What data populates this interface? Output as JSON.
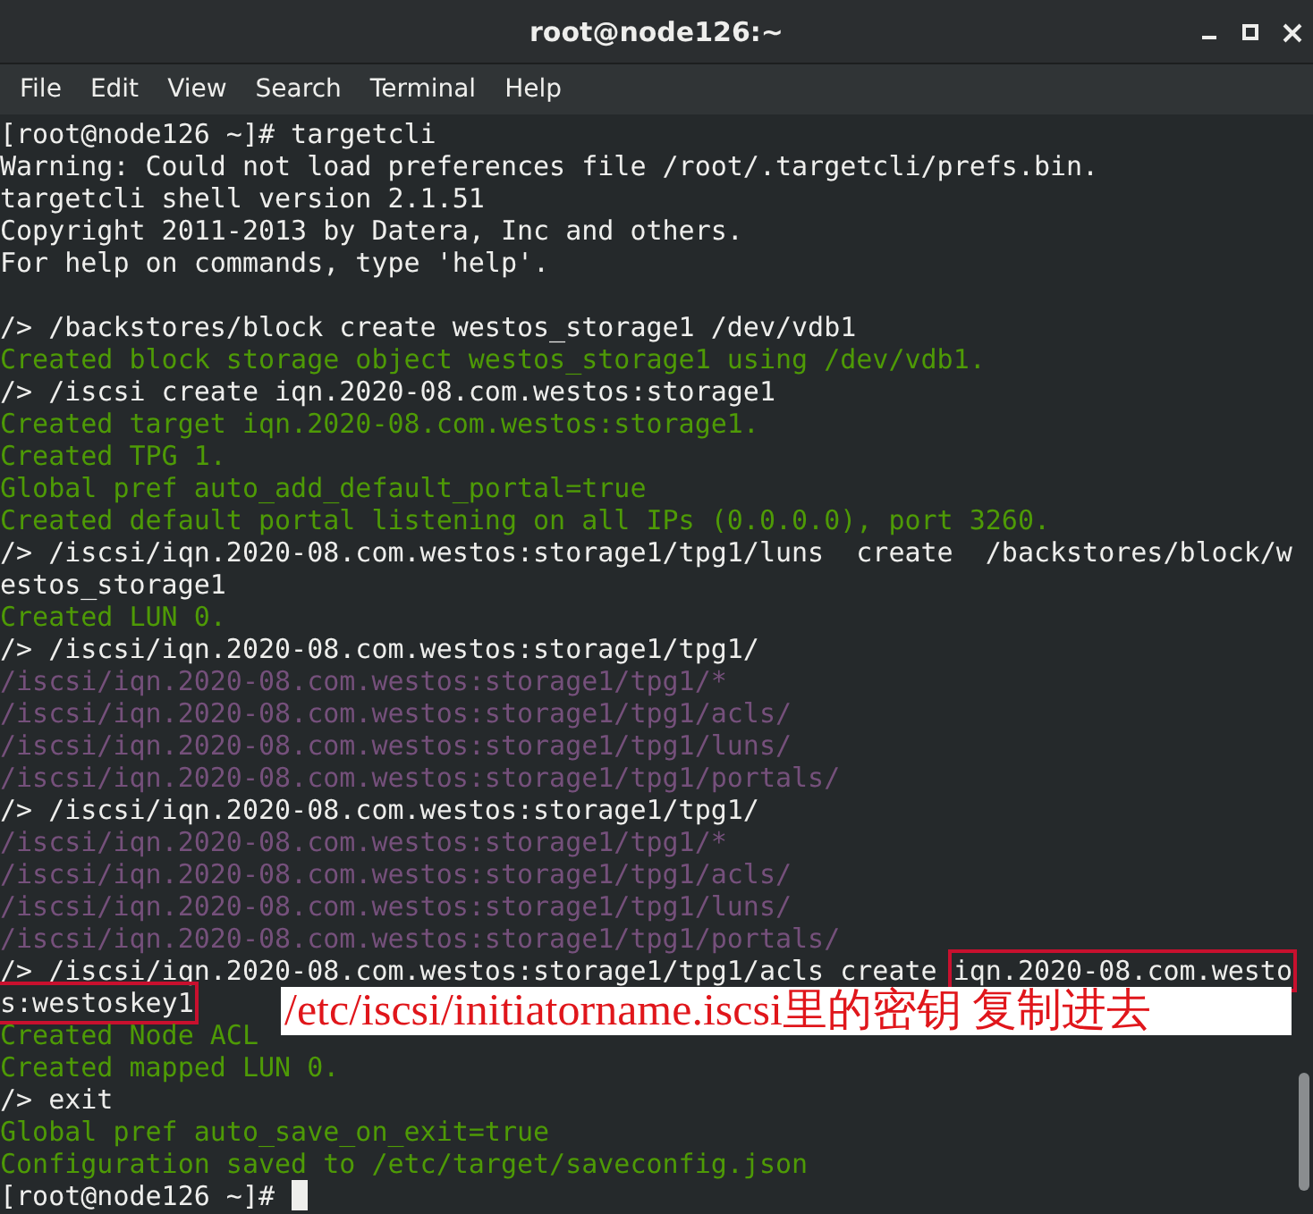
{
  "window": {
    "title": "root@node126:~"
  },
  "menu": [
    "File",
    "Edit",
    "View",
    "Search",
    "Terminal",
    "Help"
  ],
  "lines": [
    {
      "kind": "command",
      "text": "[root@node126 ~]# targetcli"
    },
    {
      "kind": "command",
      "text": "Warning: Could not load preferences file /root/.targetcli/prefs.bin."
    },
    {
      "kind": "command",
      "text": "targetcli shell version 2.1.51"
    },
    {
      "kind": "command",
      "text": "Copyright 2011-2013 by Datera, Inc and others."
    },
    {
      "kind": "command",
      "text": "For help on commands, type 'help'."
    },
    {
      "kind": "blank"
    },
    {
      "kind": "command",
      "text": "/> /backstores/block create westos_storage1 /dev/vdb1"
    },
    {
      "kind": "output",
      "text": "Created block storage object westos_storage1 using /dev/vdb1."
    },
    {
      "kind": "command",
      "text": "/> /iscsi create iqn.2020-08.com.westos:storage1"
    },
    {
      "kind": "output",
      "text": "Created target iqn.2020-08.com.westos:storage1."
    },
    {
      "kind": "output",
      "text": "Created TPG 1."
    },
    {
      "kind": "output",
      "text": "Global pref auto_add_default_portal=true"
    },
    {
      "kind": "output",
      "text": "Created default portal listening on all IPs (0.0.0.0), port 3260."
    },
    {
      "kind": "command",
      "text": "/> /iscsi/iqn.2020-08.com.westos:storage1/tpg1/luns  create  /backstores/block/w"
    },
    {
      "kind": "command",
      "text": "estos_storage1"
    },
    {
      "kind": "output",
      "text": "Created LUN 0."
    },
    {
      "kind": "command",
      "text": "/> /iscsi/iqn.2020-08.com.westos:storage1/tpg1/"
    },
    {
      "kind": "listing",
      "text": "/iscsi/iqn.2020-08.com.westos:storage1/tpg1/*"
    },
    {
      "kind": "listing",
      "text": "/iscsi/iqn.2020-08.com.westos:storage1/tpg1/acls/"
    },
    {
      "kind": "listing",
      "text": "/iscsi/iqn.2020-08.com.westos:storage1/tpg1/luns/"
    },
    {
      "kind": "listing",
      "text": "/iscsi/iqn.2020-08.com.westos:storage1/tpg1/portals/"
    },
    {
      "kind": "command",
      "text": "/> /iscsi/iqn.2020-08.com.westos:storage1/tpg1/"
    },
    {
      "kind": "listing",
      "text": "/iscsi/iqn.2020-08.com.westos:storage1/tpg1/*"
    },
    {
      "kind": "listing",
      "text": "/iscsi/iqn.2020-08.com.westos:storage1/tpg1/acls/"
    },
    {
      "kind": "listing",
      "text": "/iscsi/iqn.2020-08.com.westos:storage1/tpg1/luns/"
    },
    {
      "kind": "listing",
      "text": "/iscsi/iqn.2020-08.com.westos:storage1/tpg1/portals/"
    },
    {
      "kind": "command",
      "text": "/> /iscsi/iqn.2020-08.com.westos:storage1/tpg1/acls create ",
      "boxed": "iqn.2020-08.com.westo"
    },
    {
      "kind": "command",
      "boxed": "s:westoskey1",
      "note": "/etc/iscsi/initiatorname.iscsi里的密钥  复制进去"
    },
    {
      "kind": "output",
      "text": "Created Node ACL"
    },
    {
      "kind": "output",
      "text": "Created mapped LUN 0."
    },
    {
      "kind": "command",
      "text": "/> exit"
    },
    {
      "kind": "output",
      "text": "Global pref auto_save_on_exit=true"
    },
    {
      "kind": "output",
      "text": "Configuration saved to /etc/target/saveconfig.json"
    },
    {
      "kind": "prompt",
      "text": "[root@node126 ~]# "
    }
  ]
}
